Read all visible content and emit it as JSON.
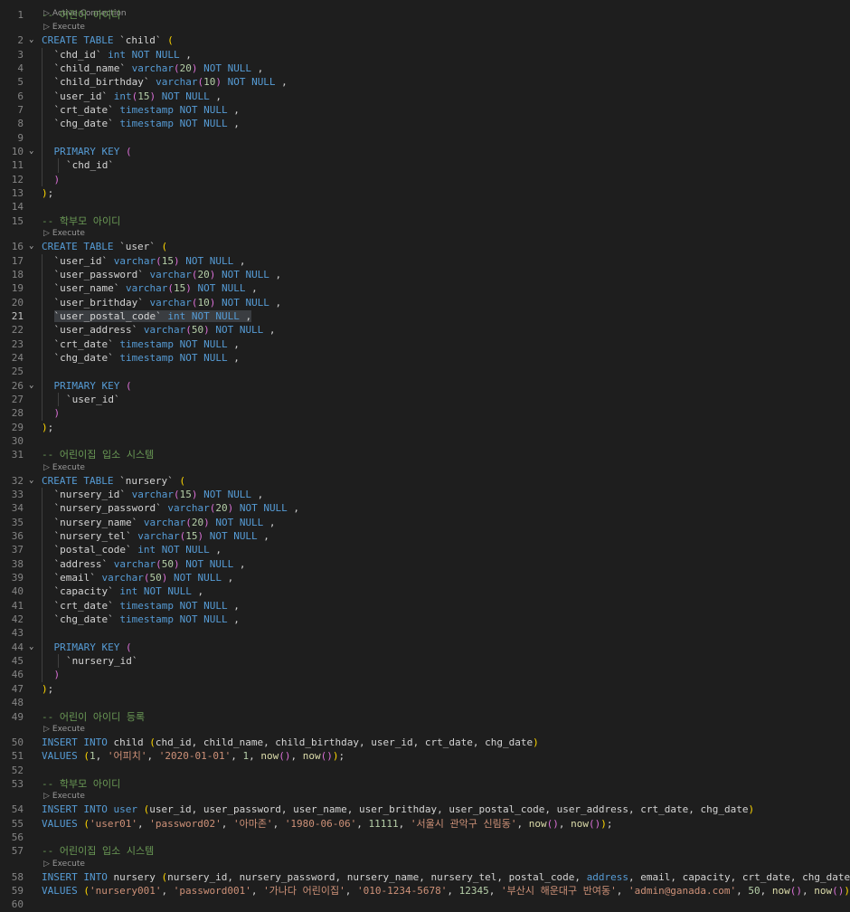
{
  "top_codelens": "Active Connection",
  "codelens_label": "Execute",
  "lines": [
    {
      "n": "1",
      "indent": 0,
      "tokens": [
        [
          "cm",
          "-- 어린이 아이디"
        ]
      ]
    },
    {
      "lens": true
    },
    {
      "n": "2",
      "indent": 0,
      "fold": true,
      "tokens": [
        [
          "kw",
          "CREATE TABLE "
        ],
        [
          "pl",
          "`child` "
        ],
        [
          "br1",
          "("
        ]
      ]
    },
    {
      "n": "3",
      "indent": 1,
      "tokens": [
        [
          "pl",
          "`chd_id` "
        ],
        [
          "ty",
          "int"
        ],
        [
          "kw",
          " NOT NULL"
        ],
        [
          "pl",
          " ,"
        ]
      ]
    },
    {
      "n": "4",
      "indent": 1,
      "tokens": [
        [
          "pl",
          "`child_name` "
        ],
        [
          "ty",
          "varchar"
        ],
        [
          "br2",
          "("
        ],
        [
          "nm",
          "20"
        ],
        [
          "br2",
          ")"
        ],
        [
          "kw",
          " NOT NULL"
        ],
        [
          "pl",
          " ,"
        ]
      ]
    },
    {
      "n": "5",
      "indent": 1,
      "tokens": [
        [
          "pl",
          "`child_birthday` "
        ],
        [
          "ty",
          "varchar"
        ],
        [
          "br2",
          "("
        ],
        [
          "nm",
          "10"
        ],
        [
          "br2",
          ")"
        ],
        [
          "kw",
          " NOT NULL"
        ],
        [
          "pl",
          " ,"
        ]
      ]
    },
    {
      "n": "6",
      "indent": 1,
      "tokens": [
        [
          "pl",
          "`user_id` "
        ],
        [
          "ty",
          "int"
        ],
        [
          "br2",
          "("
        ],
        [
          "nm",
          "15"
        ],
        [
          "br2",
          ")"
        ],
        [
          "kw",
          " NOT NULL"
        ],
        [
          "pl",
          " ,"
        ]
      ]
    },
    {
      "n": "7",
      "indent": 1,
      "tokens": [
        [
          "pl",
          "`crt_date` "
        ],
        [
          "ty",
          "timestamp"
        ],
        [
          "kw",
          " NOT NULL"
        ],
        [
          "pl",
          " ,"
        ]
      ]
    },
    {
      "n": "8",
      "indent": 1,
      "tokens": [
        [
          "pl",
          "`chg_date` "
        ],
        [
          "ty",
          "timestamp"
        ],
        [
          "kw",
          " NOT NULL"
        ],
        [
          "pl",
          " ,"
        ]
      ]
    },
    {
      "n": "9",
      "indent": 1,
      "tokens": []
    },
    {
      "n": "10",
      "indent": 1,
      "fold": true,
      "tokens": [
        [
          "kw",
          "PRIMARY KEY "
        ],
        [
          "br2",
          "("
        ]
      ]
    },
    {
      "n": "11",
      "indent": 2,
      "tokens": [
        [
          "pl",
          "`chd_id`"
        ]
      ]
    },
    {
      "n": "12",
      "indent": 1,
      "tokens": [
        [
          "br2",
          ")"
        ]
      ]
    },
    {
      "n": "13",
      "indent": 0,
      "tokens": [
        [
          "br1",
          ")"
        ],
        [
          "pl",
          ";"
        ]
      ]
    },
    {
      "n": "14",
      "indent": 0,
      "tokens": []
    },
    {
      "n": "15",
      "indent": 0,
      "tokens": [
        [
          "cm",
          "-- 학부모 아이디"
        ]
      ]
    },
    {
      "lens": true
    },
    {
      "n": "16",
      "indent": 0,
      "fold": true,
      "tokens": [
        [
          "kw",
          "CREATE TABLE "
        ],
        [
          "pl",
          "`user` "
        ],
        [
          "br1",
          "("
        ]
      ]
    },
    {
      "n": "17",
      "indent": 1,
      "tokens": [
        [
          "pl",
          "`user_id` "
        ],
        [
          "ty",
          "varchar"
        ],
        [
          "br2",
          "("
        ],
        [
          "nm",
          "15"
        ],
        [
          "br2",
          ")"
        ],
        [
          "kw",
          " NOT NULL"
        ],
        [
          "pl",
          " ,"
        ]
      ]
    },
    {
      "n": "18",
      "indent": 1,
      "tokens": [
        [
          "pl",
          "`user_password` "
        ],
        [
          "ty",
          "varchar"
        ],
        [
          "br2",
          "("
        ],
        [
          "nm",
          "20"
        ],
        [
          "br2",
          ")"
        ],
        [
          "kw",
          " NOT NULL"
        ],
        [
          "pl",
          " ,"
        ]
      ]
    },
    {
      "n": "19",
      "indent": 1,
      "tokens": [
        [
          "pl",
          "`user_name` "
        ],
        [
          "ty",
          "varchar"
        ],
        [
          "br2",
          "("
        ],
        [
          "nm",
          "15"
        ],
        [
          "br2",
          ")"
        ],
        [
          "kw",
          " NOT NULL"
        ],
        [
          "pl",
          " ,"
        ]
      ]
    },
    {
      "n": "20",
      "indent": 1,
      "tokens": [
        [
          "pl",
          "`user_brithday` "
        ],
        [
          "ty",
          "varchar"
        ],
        [
          "br2",
          "("
        ],
        [
          "nm",
          "10"
        ],
        [
          "br2",
          ")"
        ],
        [
          "kw",
          " NOT NULL"
        ],
        [
          "pl",
          " ,"
        ]
      ]
    },
    {
      "n": "21",
      "indent": 1,
      "active": true,
      "hl": true,
      "tokens": [
        [
          "pl",
          "`user_postal_code` "
        ],
        [
          "ty",
          "int"
        ],
        [
          "kw",
          " NOT NULL"
        ],
        [
          "pl",
          " ,"
        ]
      ]
    },
    {
      "n": "22",
      "indent": 1,
      "tokens": [
        [
          "pl",
          "`user_address` "
        ],
        [
          "ty",
          "varchar"
        ],
        [
          "br2",
          "("
        ],
        [
          "nm",
          "50"
        ],
        [
          "br2",
          ")"
        ],
        [
          "kw",
          " NOT NULL"
        ],
        [
          "pl",
          " ,"
        ]
      ]
    },
    {
      "n": "23",
      "indent": 1,
      "tokens": [
        [
          "pl",
          "`crt_date` "
        ],
        [
          "ty",
          "timestamp"
        ],
        [
          "kw",
          " NOT NULL"
        ],
        [
          "pl",
          " ,"
        ]
      ]
    },
    {
      "n": "24",
      "indent": 1,
      "tokens": [
        [
          "pl",
          "`chg_date` "
        ],
        [
          "ty",
          "timestamp"
        ],
        [
          "kw",
          " NOT NULL"
        ],
        [
          "pl",
          " ,"
        ]
      ]
    },
    {
      "n": "25",
      "indent": 1,
      "tokens": []
    },
    {
      "n": "26",
      "indent": 1,
      "fold": true,
      "tokens": [
        [
          "kw",
          "PRIMARY KEY "
        ],
        [
          "br2",
          "("
        ]
      ]
    },
    {
      "n": "27",
      "indent": 2,
      "tokens": [
        [
          "pl",
          "`user_id`"
        ]
      ]
    },
    {
      "n": "28",
      "indent": 1,
      "tokens": [
        [
          "br2",
          ")"
        ]
      ]
    },
    {
      "n": "29",
      "indent": 0,
      "tokens": [
        [
          "br1",
          ")"
        ],
        [
          "pl",
          ";"
        ]
      ]
    },
    {
      "n": "30",
      "indent": 0,
      "tokens": []
    },
    {
      "n": "31",
      "indent": 0,
      "tokens": [
        [
          "cm",
          "-- 어린이집 입소 시스템"
        ]
      ]
    },
    {
      "lens": true
    },
    {
      "n": "32",
      "indent": 0,
      "fold": true,
      "tokens": [
        [
          "kw",
          "CREATE TABLE "
        ],
        [
          "pl",
          "`nursery` "
        ],
        [
          "br1",
          "("
        ]
      ]
    },
    {
      "n": "33",
      "indent": 1,
      "tokens": [
        [
          "pl",
          "`nursery_id` "
        ],
        [
          "ty",
          "varchar"
        ],
        [
          "br2",
          "("
        ],
        [
          "nm",
          "15"
        ],
        [
          "br2",
          ")"
        ],
        [
          "kw",
          " NOT NULL"
        ],
        [
          "pl",
          " ,"
        ]
      ]
    },
    {
      "n": "34",
      "indent": 1,
      "tokens": [
        [
          "pl",
          "`nursery_password` "
        ],
        [
          "ty",
          "varchar"
        ],
        [
          "br2",
          "("
        ],
        [
          "nm",
          "20"
        ],
        [
          "br2",
          ")"
        ],
        [
          "kw",
          " NOT NULL"
        ],
        [
          "pl",
          " ,"
        ]
      ]
    },
    {
      "n": "35",
      "indent": 1,
      "tokens": [
        [
          "pl",
          "`nursery_name` "
        ],
        [
          "ty",
          "varchar"
        ],
        [
          "br2",
          "("
        ],
        [
          "nm",
          "20"
        ],
        [
          "br2",
          ")"
        ],
        [
          "kw",
          " NOT NULL"
        ],
        [
          "pl",
          " ,"
        ]
      ]
    },
    {
      "n": "36",
      "indent": 1,
      "tokens": [
        [
          "pl",
          "`nursery_tel` "
        ],
        [
          "ty",
          "varchar"
        ],
        [
          "br2",
          "("
        ],
        [
          "nm",
          "15"
        ],
        [
          "br2",
          ")"
        ],
        [
          "kw",
          " NOT NULL"
        ],
        [
          "pl",
          " ,"
        ]
      ]
    },
    {
      "n": "37",
      "indent": 1,
      "tokens": [
        [
          "pl",
          "`postal_code` "
        ],
        [
          "ty",
          "int"
        ],
        [
          "kw",
          " NOT NULL"
        ],
        [
          "pl",
          " ,"
        ]
      ]
    },
    {
      "n": "38",
      "indent": 1,
      "tokens": [
        [
          "pl",
          "`address` "
        ],
        [
          "ty",
          "varchar"
        ],
        [
          "br2",
          "("
        ],
        [
          "nm",
          "50"
        ],
        [
          "br2",
          ")"
        ],
        [
          "kw",
          " NOT NULL"
        ],
        [
          "pl",
          " ,"
        ]
      ]
    },
    {
      "n": "39",
      "indent": 1,
      "tokens": [
        [
          "pl",
          "`email` "
        ],
        [
          "ty",
          "varchar"
        ],
        [
          "br2",
          "("
        ],
        [
          "nm",
          "50"
        ],
        [
          "br2",
          ")"
        ],
        [
          "kw",
          " NOT NULL"
        ],
        [
          "pl",
          " ,"
        ]
      ]
    },
    {
      "n": "40",
      "indent": 1,
      "tokens": [
        [
          "pl",
          "`capacity` "
        ],
        [
          "ty",
          "int"
        ],
        [
          "kw",
          " NOT NULL"
        ],
        [
          "pl",
          " ,"
        ]
      ]
    },
    {
      "n": "41",
      "indent": 1,
      "tokens": [
        [
          "pl",
          "`crt_date` "
        ],
        [
          "ty",
          "timestamp"
        ],
        [
          "kw",
          " NOT NULL"
        ],
        [
          "pl",
          " ,"
        ]
      ]
    },
    {
      "n": "42",
      "indent": 1,
      "tokens": [
        [
          "pl",
          "`chg_date` "
        ],
        [
          "ty",
          "timestamp"
        ],
        [
          "kw",
          " NOT NULL"
        ],
        [
          "pl",
          " ,"
        ]
      ]
    },
    {
      "n": "43",
      "indent": 1,
      "tokens": []
    },
    {
      "n": "44",
      "indent": 1,
      "fold": true,
      "tokens": [
        [
          "kw",
          "PRIMARY KEY "
        ],
        [
          "br2",
          "("
        ]
      ]
    },
    {
      "n": "45",
      "indent": 2,
      "tokens": [
        [
          "pl",
          "`nursery_id`"
        ]
      ]
    },
    {
      "n": "46",
      "indent": 1,
      "tokens": [
        [
          "br2",
          ")"
        ]
      ]
    },
    {
      "n": "47",
      "indent": 0,
      "tokens": [
        [
          "br1",
          ")"
        ],
        [
          "pl",
          ";"
        ]
      ]
    },
    {
      "n": "48",
      "indent": 0,
      "tokens": []
    },
    {
      "n": "49",
      "indent": 0,
      "tokens": [
        [
          "cm",
          "-- 어린이 아이디 등록"
        ]
      ]
    },
    {
      "lens": true
    },
    {
      "n": "50",
      "indent": 0,
      "tokens": [
        [
          "kw",
          "INSERT INTO "
        ],
        [
          "pl",
          "child "
        ],
        [
          "br1",
          "("
        ],
        [
          "pl",
          "chd_id, child_name, child_birthday, user_id, crt_date, chg_date"
        ],
        [
          "br1",
          ")"
        ]
      ]
    },
    {
      "n": "51",
      "indent": 0,
      "tokens": [
        [
          "kw",
          "VALUES "
        ],
        [
          "br1",
          "("
        ],
        [
          "nm",
          "1"
        ],
        [
          "pl",
          ", "
        ],
        [
          "st",
          "'어피치'"
        ],
        [
          "pl",
          ", "
        ],
        [
          "st",
          "'2020-01-01'"
        ],
        [
          "pl",
          ", "
        ],
        [
          "nm",
          "1"
        ],
        [
          "pl",
          ", "
        ],
        [
          "fn",
          "now"
        ],
        [
          "br2",
          "()"
        ],
        [
          "pl",
          ", "
        ],
        [
          "fn",
          "now"
        ],
        [
          "br2",
          "()"
        ],
        [
          "br1",
          ")"
        ],
        [
          "pl",
          ";"
        ]
      ]
    },
    {
      "n": "52",
      "indent": 0,
      "tokens": []
    },
    {
      "n": "53",
      "indent": 0,
      "tokens": [
        [
          "cm",
          "-- 학부모 아이디"
        ]
      ]
    },
    {
      "lens": true
    },
    {
      "n": "54",
      "indent": 0,
      "tokens": [
        [
          "kw",
          "INSERT INTO "
        ],
        [
          "kw",
          "user "
        ],
        [
          "br1",
          "("
        ],
        [
          "pl",
          "user_id, user_password, user_name, user_brithday, user_postal_code, user_address, crt_date, chg_date"
        ],
        [
          "br1",
          ")"
        ]
      ]
    },
    {
      "n": "55",
      "indent": 0,
      "tokens": [
        [
          "kw",
          "VALUES "
        ],
        [
          "br1",
          "("
        ],
        [
          "st",
          "'user01'"
        ],
        [
          "pl",
          ", "
        ],
        [
          "st",
          "'password02'"
        ],
        [
          "pl",
          ", "
        ],
        [
          "st",
          "'아마존'"
        ],
        [
          "pl",
          ", "
        ],
        [
          "st",
          "'1980-06-06'"
        ],
        [
          "pl",
          ", "
        ],
        [
          "nm",
          "11111"
        ],
        [
          "pl",
          ", "
        ],
        [
          "st",
          "'서울시 관악구 신림동'"
        ],
        [
          "pl",
          ", "
        ],
        [
          "fn",
          "now"
        ],
        [
          "br2",
          "()"
        ],
        [
          "pl",
          ", "
        ],
        [
          "fn",
          "now"
        ],
        [
          "br2",
          "()"
        ],
        [
          "br1",
          ")"
        ],
        [
          "pl",
          ";"
        ]
      ]
    },
    {
      "n": "56",
      "indent": 0,
      "tokens": []
    },
    {
      "n": "57",
      "indent": 0,
      "tokens": [
        [
          "cm",
          "-- 어린이집 입소 시스템"
        ]
      ]
    },
    {
      "lens": true
    },
    {
      "n": "58",
      "indent": 0,
      "tokens": [
        [
          "kw",
          "INSERT INTO "
        ],
        [
          "pl",
          "nursery "
        ],
        [
          "br1",
          "("
        ],
        [
          "pl",
          "nursery_id, nursery_password, nursery_name, nursery_tel, postal_code, "
        ],
        [
          "kw",
          "address"
        ],
        [
          "pl",
          ", email, capacity, crt_date, chg_date"
        ],
        [
          "br1",
          ")"
        ]
      ]
    },
    {
      "n": "59",
      "indent": 0,
      "tokens": [
        [
          "kw",
          "VALUES "
        ],
        [
          "br1",
          "("
        ],
        [
          "st",
          "'nursery001'"
        ],
        [
          "pl",
          ", "
        ],
        [
          "st",
          "'password001'"
        ],
        [
          "pl",
          ", "
        ],
        [
          "st",
          "'가나다 어린이집'"
        ],
        [
          "pl",
          ", "
        ],
        [
          "st",
          "'010-1234-5678'"
        ],
        [
          "pl",
          ", "
        ],
        [
          "nm",
          "12345"
        ],
        [
          "pl",
          ", "
        ],
        [
          "st",
          "'부산시 해운대구 반여동'"
        ],
        [
          "pl",
          ", "
        ],
        [
          "st",
          "'admin@ganada.com'"
        ],
        [
          "pl",
          ", "
        ],
        [
          "nm",
          "50"
        ],
        [
          "pl",
          ", "
        ],
        [
          "fn",
          "now"
        ],
        [
          "br2",
          "()"
        ],
        [
          "pl",
          ", "
        ],
        [
          "fn",
          "now"
        ],
        [
          "br2",
          "()"
        ],
        [
          "br1",
          ")"
        ],
        [
          "pl",
          ";"
        ]
      ]
    },
    {
      "n": "60",
      "indent": 0,
      "tokens": []
    }
  ]
}
